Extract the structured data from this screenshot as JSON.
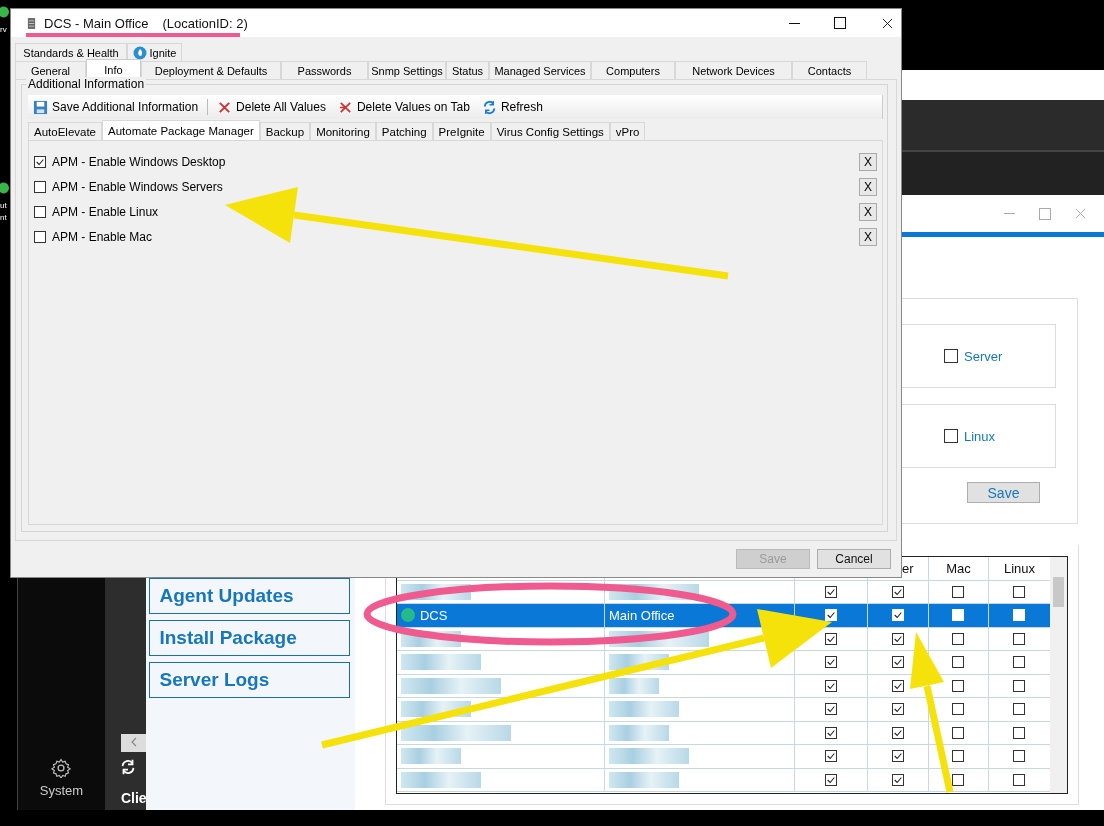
{
  "desktop_icons": [
    {
      "lines": [
        "rv"
      ]
    },
    {
      "lines": [
        "ut",
        "nt"
      ]
    }
  ],
  "app": {
    "nav": [
      {
        "label": "System"
      }
    ],
    "rail_label": "Clie",
    "menu": [
      "Agent Updates",
      "Install Package",
      "Server Logs"
    ],
    "grid": {
      "column_headers": [
        "er",
        "Mac",
        "Linux"
      ],
      "rows": [
        {
          "selected": false,
          "checks": [
            true,
            true,
            false,
            false
          ]
        },
        {
          "name": "DCS",
          "location": "Main Office",
          "selected": true,
          "checks": [
            true,
            true,
            false,
            false
          ]
        },
        {
          "selected": false,
          "checks": [
            true,
            true,
            false,
            false
          ]
        },
        {
          "selected": false,
          "checks": [
            true,
            true,
            false,
            false
          ]
        },
        {
          "selected": false,
          "checks": [
            true,
            true,
            false,
            false
          ]
        },
        {
          "selected": false,
          "checks": [
            true,
            true,
            false,
            false
          ]
        },
        {
          "selected": false,
          "checks": [
            true,
            true,
            false,
            false
          ]
        },
        {
          "selected": false,
          "checks": [
            true,
            true,
            false,
            false
          ]
        },
        {
          "selected": false,
          "checks": [
            true,
            true,
            false,
            false
          ]
        }
      ]
    }
  },
  "side_window": {
    "options": [
      {
        "label": "Server",
        "checked": false
      },
      {
        "label": "Linux",
        "checked": false
      }
    ],
    "save_button": "Save"
  },
  "dialog": {
    "title": "DCS - Main Office",
    "subtitle": "(LocationID: 2)",
    "tab_rows": [
      [
        {
          "label": "Standards & Health",
          "kind": "text",
          "selected": false
        },
        {
          "label": "Ignite",
          "kind": "icon",
          "selected": false
        }
      ],
      [
        {
          "label": "General",
          "kind": "text",
          "selected": false
        },
        {
          "label": "Info",
          "kind": "text",
          "selected": true
        },
        {
          "label": "Deployment & Defaults",
          "kind": "text",
          "selected": false
        },
        {
          "label": "Passwords",
          "kind": "text",
          "selected": false
        },
        {
          "label": "Snmp Settings",
          "kind": "text",
          "selected": false
        },
        {
          "label": "Status",
          "kind": "text",
          "selected": false
        },
        {
          "label": "Managed Services",
          "kind": "text",
          "selected": false
        },
        {
          "label": "Computers",
          "kind": "text",
          "selected": false
        },
        {
          "label": "Network Devices",
          "kind": "text",
          "selected": false
        },
        {
          "label": "Contacts",
          "kind": "text",
          "selected": false
        }
      ]
    ],
    "group_title": "Additional Information",
    "toolbar": [
      {
        "label": "Save Additional Information",
        "kind": "save"
      },
      {
        "label": "Delete All Values",
        "kind": "delete"
      },
      {
        "label": "Delete Values on Tab",
        "kind": "delete-tab"
      },
      {
        "label": "Refresh",
        "kind": "refresh"
      }
    ],
    "subtabs": [
      {
        "label": "AutoElevate",
        "selected": false
      },
      {
        "label": "Automate Package Manager",
        "selected": true
      },
      {
        "label": "Backup",
        "selected": false
      },
      {
        "label": "Monitoring",
        "selected": false
      },
      {
        "label": "Patching",
        "selected": false
      },
      {
        "label": "PreIgnite",
        "selected": false
      },
      {
        "label": "Virus Config Settings",
        "selected": false
      },
      {
        "label": "vPro",
        "selected": false
      }
    ],
    "options": [
      {
        "label": "APM - Enable Windows Desktop",
        "checked": true,
        "clear": "X"
      },
      {
        "label": "APM - Enable Windows Servers",
        "checked": false,
        "clear": "X"
      },
      {
        "label": "APM - Enable Linux",
        "checked": false,
        "clear": "X"
      },
      {
        "label": "APM - Enable Mac",
        "checked": false,
        "clear": "X"
      }
    ],
    "buttons": [
      {
        "label": "Save",
        "disabled": true
      },
      {
        "label": "Cancel",
        "disabled": false
      }
    ]
  }
}
